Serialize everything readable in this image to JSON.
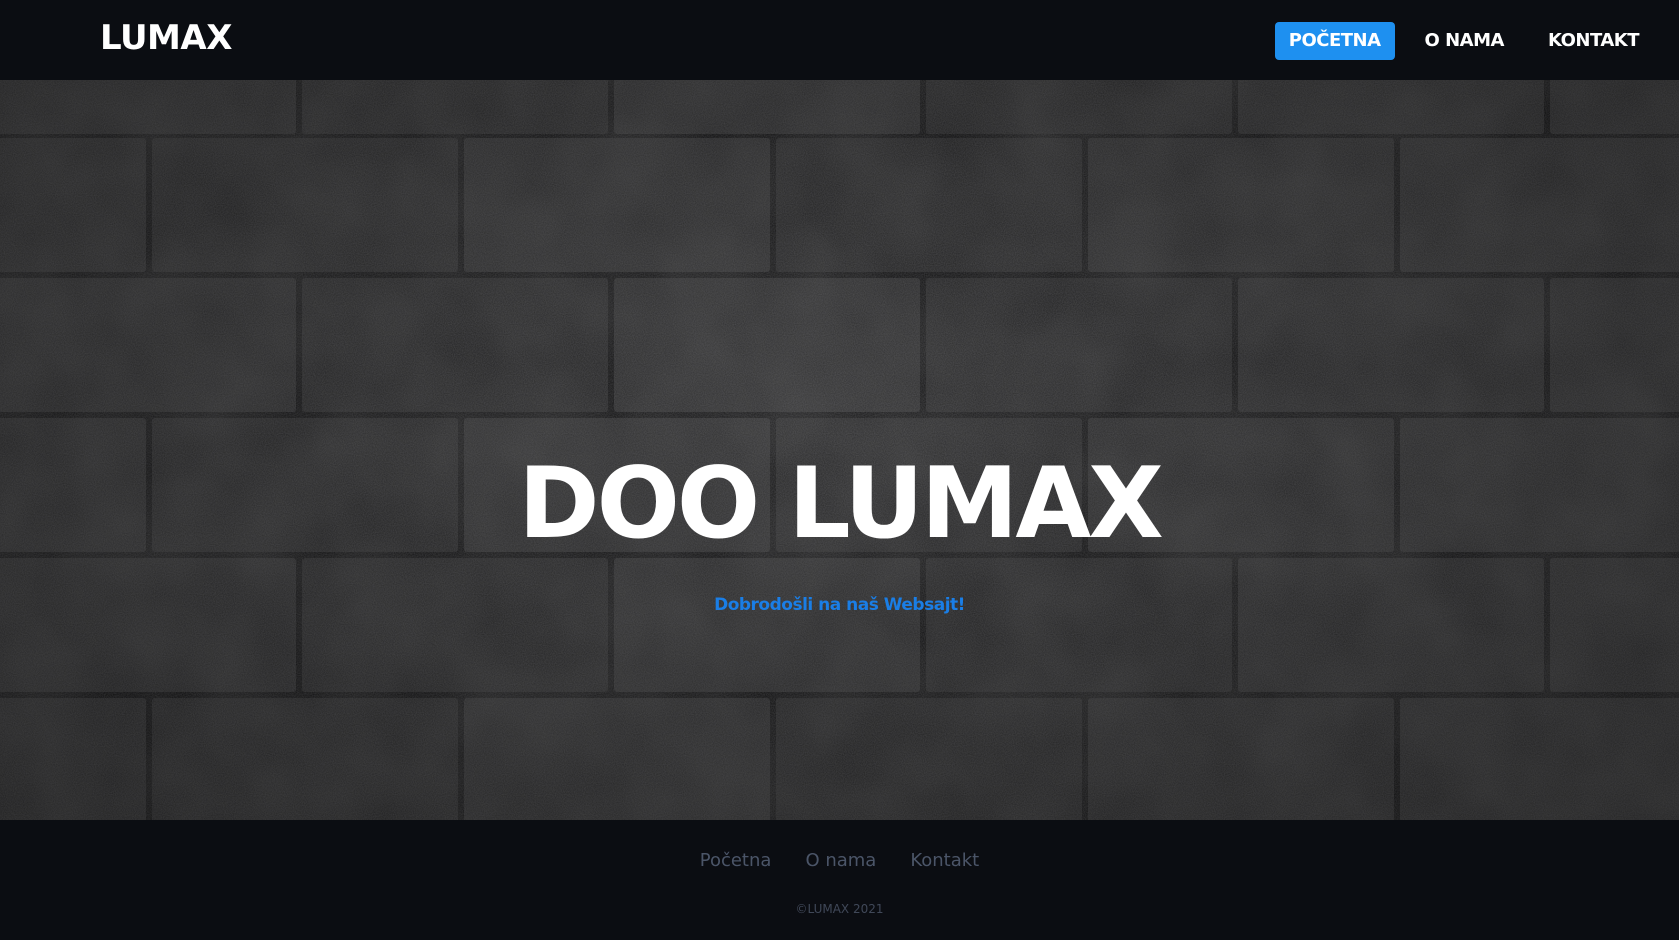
{
  "colors": {
    "background": "#0b0d12",
    "accent": "#1e90f0",
    "subtitle": "#1a7ee6",
    "footer_text": "#4b5568"
  },
  "navbar": {
    "logo": "LUMAX",
    "links": [
      {
        "label": "POČETNA",
        "active": true
      },
      {
        "label": "O NAMA",
        "active": false
      },
      {
        "label": "KONTAKT",
        "active": false
      }
    ]
  },
  "hero": {
    "title": "DOO LUMAX",
    "subtitle": "Dobrodošli na naš Websajt!",
    "background": "dark-stone-brick-wall"
  },
  "footer": {
    "links": [
      {
        "label": "Početna"
      },
      {
        "label": "O nama"
      },
      {
        "label": "Kontakt"
      }
    ],
    "copyright": "©LUMAX 2021"
  }
}
